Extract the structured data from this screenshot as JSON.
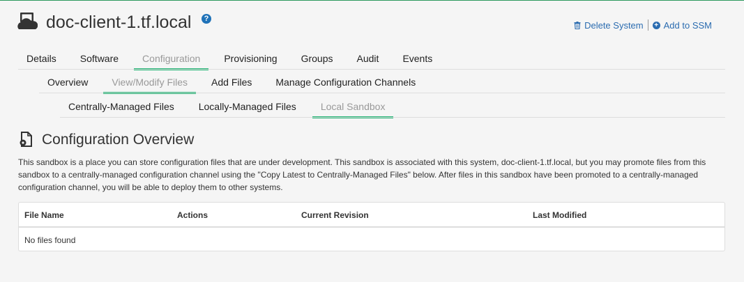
{
  "system": {
    "title": "doc-client-1.tf.local",
    "help_icon": "?"
  },
  "actions": {
    "delete_label": "Delete System",
    "add_label": "Add to SSM"
  },
  "tabs_main": [
    "Details",
    "Software",
    "Configuration",
    "Provisioning",
    "Groups",
    "Audit",
    "Events"
  ],
  "tabs_config": [
    "Overview",
    "View/Modify Files",
    "Add Files",
    "Manage Configuration Channels"
  ],
  "tabs_files": [
    "Centrally-Managed Files",
    "Locally-Managed Files",
    "Local Sandbox"
  ],
  "section": {
    "title": "Configuration Overview",
    "description": "This sandbox is a place you can store configuration files that are under development. This sandbox is associated with this system, doc-client-1.tf.local, but you may promote files from this sandbox to a centrally-managed configuration channel using the \"Copy Latest to Centrally-Managed Files\" below. After files in this sandbox have been promoted to a centrally-managed configuration channel, you will be able to deploy them to other systems."
  },
  "table": {
    "columns": [
      "File Name",
      "Actions",
      "Current Revision",
      "Last Modified"
    ],
    "empty_message": "No files found"
  },
  "colors": {
    "accent": "#1fb473",
    "link": "#2b6cb0"
  }
}
